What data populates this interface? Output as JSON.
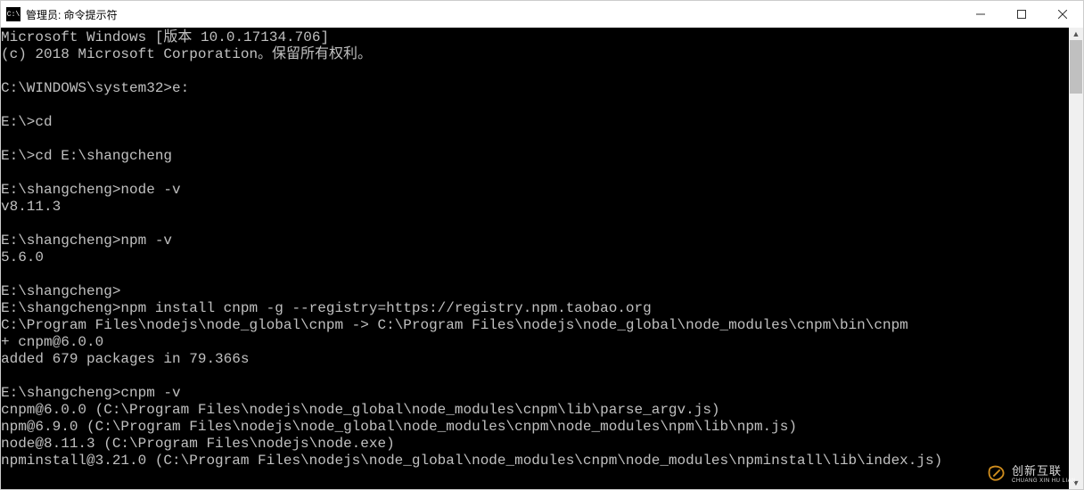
{
  "window": {
    "icon_text": "C:\\",
    "title": "管理员: 命令提示符"
  },
  "terminal": {
    "lines": [
      "Microsoft Windows [版本 10.0.17134.706]",
      "(c) 2018 Microsoft Corporation。保留所有权利。",
      "",
      "C:\\WINDOWS\\system32>e:",
      "",
      "E:\\>cd",
      "",
      "E:\\>cd E:\\shangcheng",
      "",
      "E:\\shangcheng>node -v",
      "v8.11.3",
      "",
      "E:\\shangcheng>npm -v",
      "5.6.0",
      "",
      "E:\\shangcheng>",
      "E:\\shangcheng>npm install cnpm -g --registry=https://registry.npm.taobao.org",
      "C:\\Program Files\\nodejs\\node_global\\cnpm -> C:\\Program Files\\nodejs\\node_global\\node_modules\\cnpm\\bin\\cnpm",
      "+ cnpm@6.0.0",
      "added 679 packages in 79.366s",
      "",
      "E:\\shangcheng>cnpm -v",
      "cnpm@6.0.0 (C:\\Program Files\\nodejs\\node_global\\node_modules\\cnpm\\lib\\parse_argv.js)",
      "npm@6.9.0 (C:\\Program Files\\nodejs\\node_global\\node_modules\\cnpm\\node_modules\\npm\\lib\\npm.js)",
      "node@8.11.3 (C:\\Program Files\\nodejs\\node.exe)",
      "npminstall@3.21.0 (C:\\Program Files\\nodejs\\node_global\\node_modules\\cnpm\\node_modules\\npminstall\\lib\\index.js)"
    ]
  },
  "watermark": {
    "text": "创新互联",
    "sub": "CHUANG XIN HU LIAN"
  }
}
